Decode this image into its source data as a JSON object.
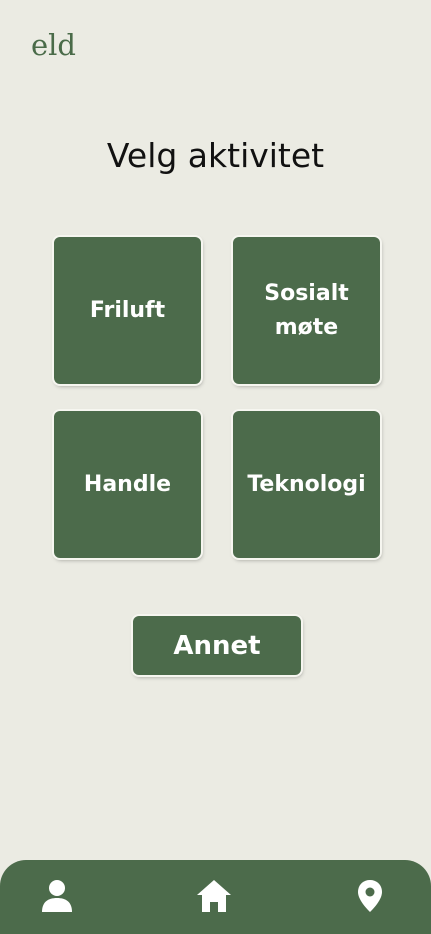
{
  "app": {
    "logo_text": "eld"
  },
  "page": {
    "title": "Velg aktivitet"
  },
  "activities": [
    {
      "label": "Friluft"
    },
    {
      "label": "Sosialt møte"
    },
    {
      "label": "Handle"
    },
    {
      "label": "Teknologi"
    }
  ],
  "other_button": {
    "label": "Annet"
  },
  "bottom_nav": {
    "items": [
      {
        "icon": "person-icon"
      },
      {
        "icon": "home-icon"
      },
      {
        "icon": "location-pin-icon"
      }
    ]
  },
  "colors": {
    "background": "#ebebe3",
    "accent": "#4c6b4b",
    "text": "#111111",
    "on_accent": "#ffffff"
  }
}
